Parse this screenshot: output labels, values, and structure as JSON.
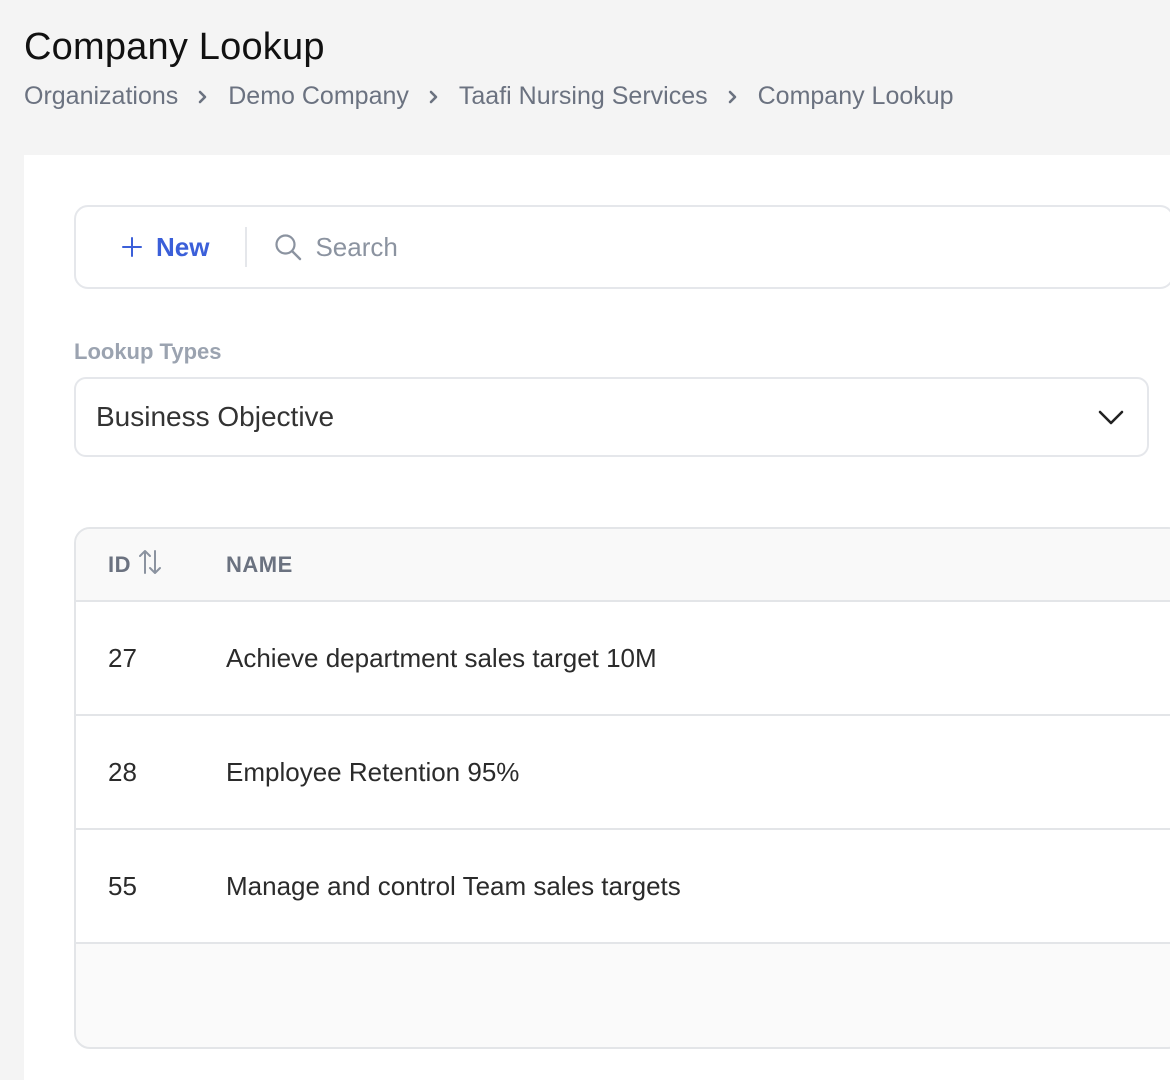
{
  "page": {
    "title": "Company Lookup"
  },
  "breadcrumb": [
    {
      "label": "Organizations"
    },
    {
      "label": "Demo Company"
    },
    {
      "label": "Taafi Nursing Services"
    },
    {
      "label": "Company Lookup"
    }
  ],
  "toolbar": {
    "new_label": "New",
    "search_placeholder": "Search"
  },
  "lookup": {
    "label": "Lookup Types",
    "selected": "Business Objective"
  },
  "table": {
    "columns": {
      "id": "ID",
      "name": "NAME"
    },
    "rows": [
      {
        "id": "27",
        "name": "Achieve department sales target 10M"
      },
      {
        "id": "28",
        "name": "Employee Retention 95%"
      },
      {
        "id": "55",
        "name": "Manage and control Team sales targets"
      }
    ]
  },
  "colors": {
    "accent": "#3b5fd9",
    "background": "#f4f4f4",
    "panel": "#ffffff",
    "border": "#e5e7eb"
  },
  "icons": [
    "plus-icon",
    "search-icon",
    "chevron-down-icon",
    "chevron-right-icon",
    "sort-icon"
  ]
}
